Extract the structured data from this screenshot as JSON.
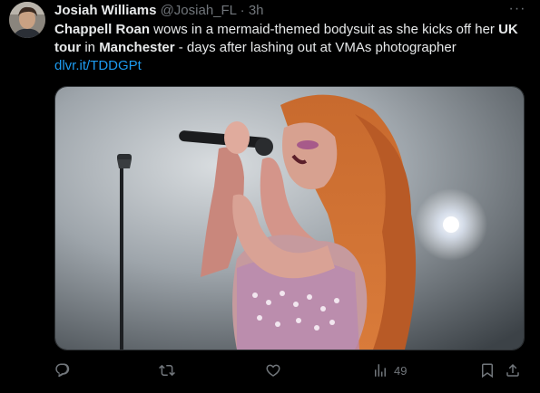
{
  "author": {
    "name": "Josiah Williams",
    "handle": "@Josiah_FL",
    "separator": "·",
    "time": "3h"
  },
  "menu": {
    "more_label": "···"
  },
  "tweet": {
    "part1": "Chappell Roan",
    "part2": " wows in a mermaid-themed bodysuit as she kicks off her ",
    "part3": "UK tour",
    "part4": " in ",
    "part5": "Manchester",
    "part6": " - days after lashing out at VMAs photographer",
    "link": "dlvr.it/TDDGPt"
  },
  "media": {
    "description_icon": "photo"
  },
  "actions": {
    "reply_icon": "reply-icon",
    "retweet_icon": "retweet-icon",
    "like_icon": "heart-icon",
    "views_icon": "views-icon",
    "views_count": "49",
    "bookmark_icon": "bookmark-icon",
    "share_icon": "share-icon"
  },
  "colors": {
    "background": "#000000",
    "text": "#e7e9ea",
    "muted": "#71767b",
    "link": "#1d9bf0"
  }
}
